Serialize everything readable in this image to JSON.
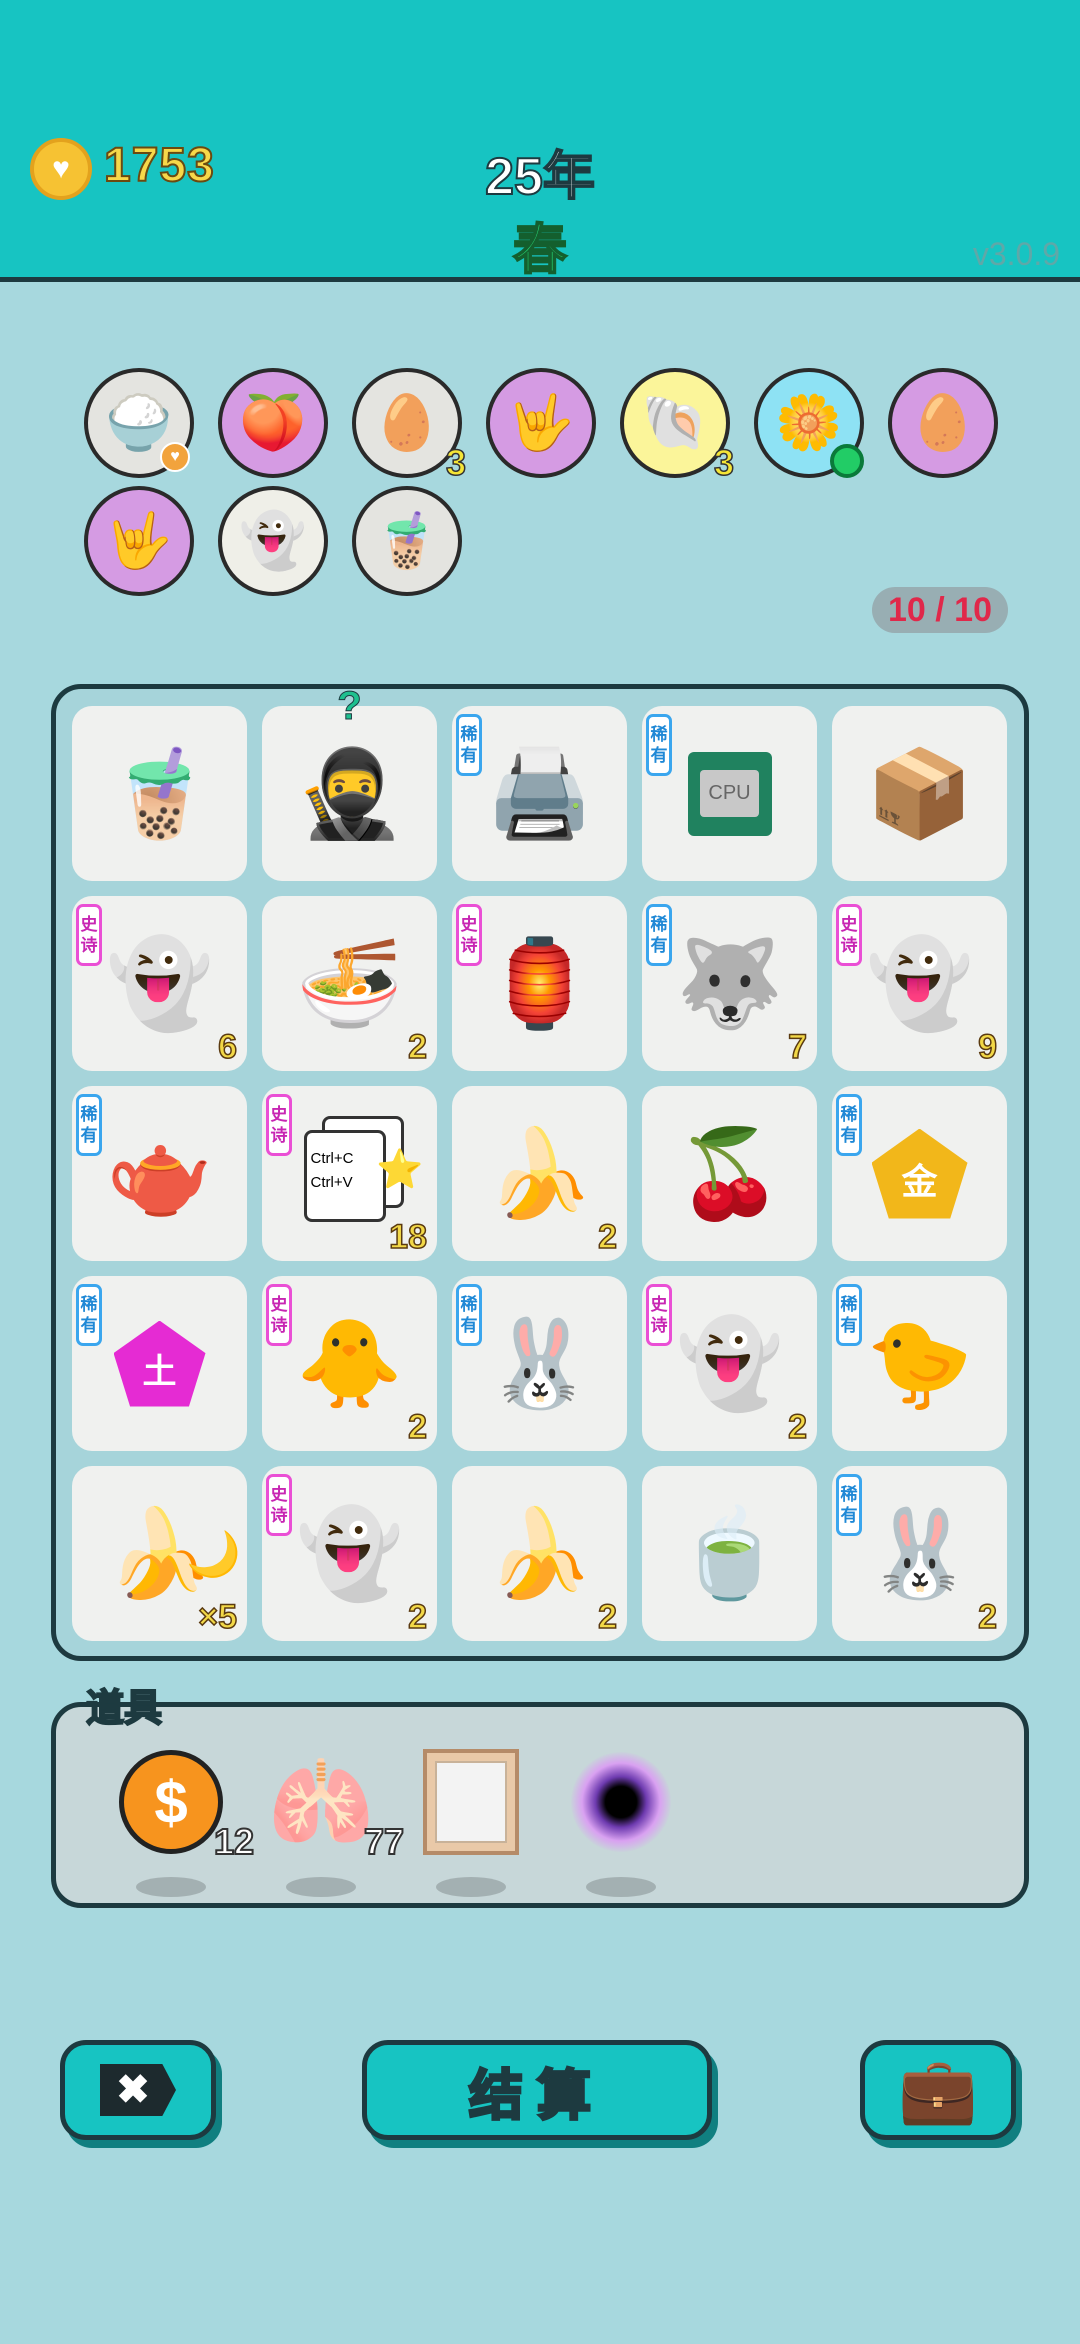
{
  "header": {
    "money": "1753",
    "year": "25年",
    "season": "春",
    "version": "v3.0.9"
  },
  "relics": [
    {
      "icon": "rice-bowl-icon",
      "glyph": "🍚",
      "bg": "grey",
      "badge": "heart"
    },
    {
      "icon": "eyepatch-peach-icon",
      "glyph": "🍑",
      "bg": "purple"
    },
    {
      "icon": "egg-tray-icon",
      "glyph": "🥚",
      "bg": "grey",
      "count": "3"
    },
    {
      "icon": "rock-hand-icon",
      "glyph": "🤟",
      "bg": "purple"
    },
    {
      "icon": "shell-icon",
      "glyph": "🐚",
      "bg": "yellow",
      "count": "3"
    },
    {
      "icon": "potted-flower-icon",
      "glyph": "🌼",
      "bg": "blue",
      "badge": "dot"
    },
    {
      "icon": "egg-face-icon",
      "glyph": "🥚",
      "bg": "purple"
    },
    {
      "icon": "rock-hand-icon",
      "glyph": "🤟",
      "bg": "purple"
    },
    {
      "icon": "ghost-tongue-icon",
      "glyph": "👻",
      "bg": "cream"
    },
    {
      "icon": "milk-tea-icon",
      "glyph": "🧋",
      "bg": "grey"
    }
  ],
  "slots": "10 / 10",
  "tags": {
    "rare": [
      "稀",
      "有"
    ],
    "epic": [
      "史",
      "诗"
    ]
  },
  "board": [
    {
      "name": "milk-tea",
      "glyph": "🧋"
    },
    {
      "name": "thief",
      "glyph": "🥷",
      "question": "?"
    },
    {
      "name": "printer",
      "glyph": "🖨️",
      "tag": "rare"
    },
    {
      "name": "cpu",
      "cpu": "CPU",
      "tag": "rare"
    },
    {
      "name": "box",
      "glyph": "📦"
    },
    {
      "name": "ghost",
      "glyph": "👻",
      "tag": "epic",
      "count": "6"
    },
    {
      "name": "basketball-bowl",
      "glyph": "🍜",
      "count": "2"
    },
    {
      "name": "rabbit-house",
      "glyph": "🏮",
      "tag": "epic"
    },
    {
      "name": "husky",
      "glyph": "🐺",
      "tag": "rare",
      "count": "7"
    },
    {
      "name": "ghost",
      "glyph": "👻",
      "tag": "epic",
      "count": "9"
    },
    {
      "name": "teapot",
      "glyph": "🫖",
      "tag": "rare"
    },
    {
      "name": "ctrl-cv",
      "ctrl": [
        "Ctrl+C",
        "Ctrl+V"
      ],
      "tag": "epic",
      "count": "18"
    },
    {
      "name": "banana",
      "glyph": "🍌",
      "count": "2"
    },
    {
      "name": "cherry",
      "glyph": "🍒"
    },
    {
      "name": "gold",
      "gold": "金",
      "tag": "rare"
    },
    {
      "name": "earth",
      "earth": "土",
      "tag": "rare"
    },
    {
      "name": "chick-hair",
      "glyph": "🐥",
      "tag": "epic",
      "count": "2"
    },
    {
      "name": "rabbit",
      "glyph": "🐰",
      "tag": "rare"
    },
    {
      "name": "ghost",
      "glyph": "👻",
      "tag": "epic",
      "count": "2"
    },
    {
      "name": "chicken",
      "glyph": "🐤",
      "tag": "rare"
    },
    {
      "name": "banana-moon",
      "glyph": "🍌",
      "moon": "🌙",
      "count": "×5"
    },
    {
      "name": "ghost",
      "glyph": "👻",
      "tag": "epic",
      "count": "2"
    },
    {
      "name": "banana",
      "glyph": "🍌",
      "count": "2"
    },
    {
      "name": "tea-bag",
      "glyph": "🍵"
    },
    {
      "name": "rabbit",
      "glyph": "🐰",
      "tag": "rare",
      "count": "2"
    }
  ],
  "tools": {
    "label": "道具",
    "items": [
      {
        "name": "coin",
        "glyph": "$",
        "count": "12"
      },
      {
        "name": "liver",
        "glyph": "🫁",
        "count": "77"
      },
      {
        "name": "frame"
      },
      {
        "name": "black-hole"
      }
    ]
  },
  "buttons": {
    "close": "✖",
    "settle": "结算",
    "bag": "💼"
  },
  "colors": {
    "header": "#17c4c2",
    "background": "#a7d8de",
    "rare": "#3aa6ee",
    "epic": "#ea4fd5",
    "count": "#f2d847"
  }
}
